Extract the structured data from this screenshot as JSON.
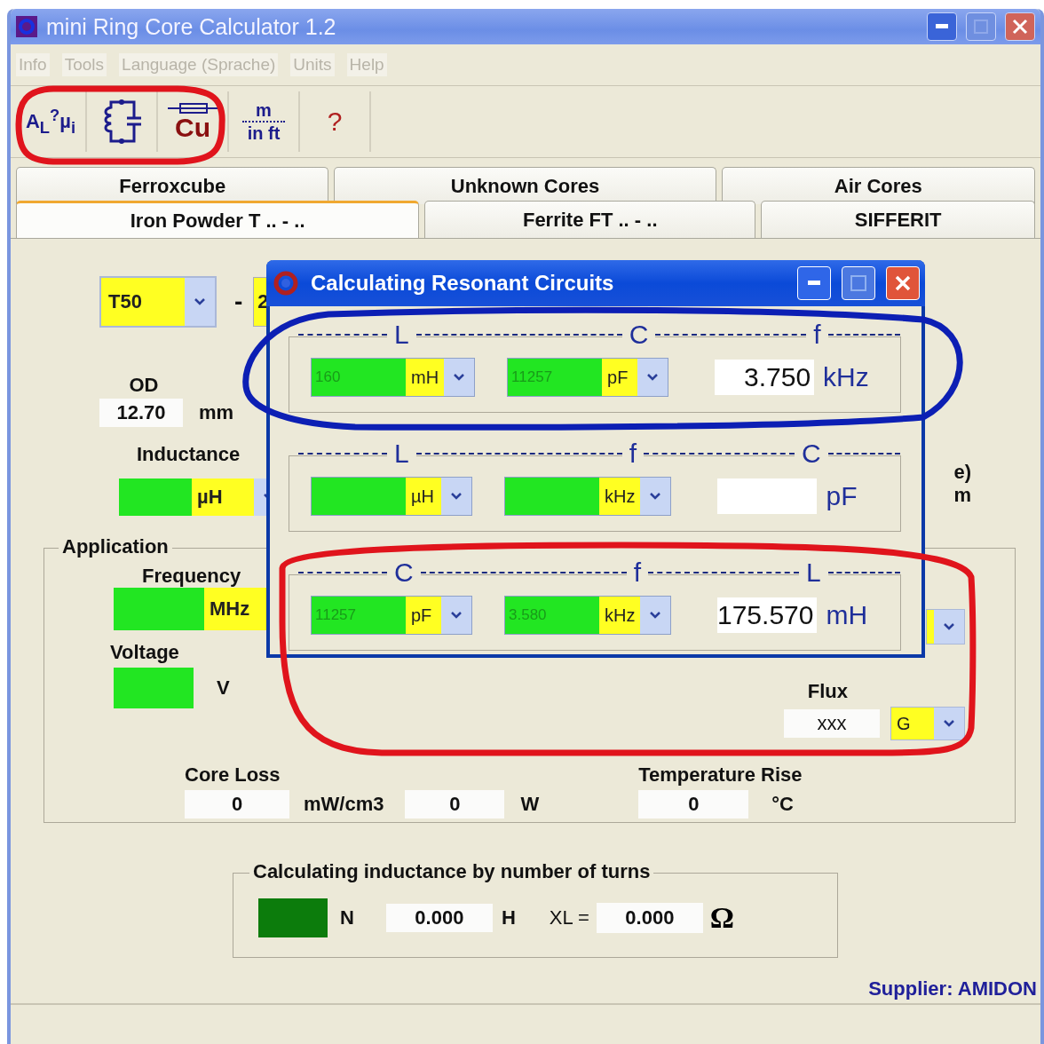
{
  "window": {
    "title": "mini Ring Core Calculator 1.2"
  },
  "menu": [
    "Info",
    "Tools",
    "Language (Sprache)",
    "Units",
    "Help"
  ],
  "toolbar": [
    {
      "kind": "formula",
      "label": "A$_{L}$$^{?}$µ$_{i}$"
    },
    {
      "kind": "circuit"
    },
    {
      "kind": "wire",
      "label": "Cu"
    },
    {
      "kind": "units",
      "label": "m",
      "sublabel": "in ft"
    },
    {
      "kind": "help",
      "label": "?"
    }
  ],
  "tab_rows": [
    [
      {
        "label": "Ferroxcube",
        "selected": false
      },
      {
        "label": "Unknown Cores",
        "selected": false
      },
      {
        "label": "Air Cores",
        "selected": false
      }
    ],
    [
      {
        "label": "Iron Powder T .. - ..",
        "selected": true
      },
      {
        "label": "Ferrite FT .. - ..",
        "selected": false
      },
      {
        "label": "SIFFERIT",
        "selected": false
      }
    ]
  ],
  "core": {
    "type": "T50",
    "separator": "-",
    "mix": "2"
  },
  "od": {
    "label": "OD",
    "value": "12.70",
    "unit": "mm"
  },
  "inductance": {
    "label": "Inductance",
    "unit": "µH"
  },
  "right_label_fragments": [
    "e)",
    "m"
  ],
  "application": {
    "title": "Application",
    "frequency": {
      "label": "Frequency",
      "unit": "MHz"
    },
    "voltage": {
      "label": "Voltage",
      "unit": "V"
    },
    "flux": {
      "label": "Flux",
      "value": "xxx",
      "unit": "G"
    },
    "core_loss": {
      "label": "Core Loss",
      "density": "0",
      "density_unit": "mW/cm3",
      "power": "0",
      "power_unit": "W"
    },
    "temperature_rise": {
      "label": "Temperature Rise",
      "value": "0",
      "unit": "°C"
    }
  },
  "turns": {
    "title": "Calculating inductance by number of turns",
    "n_label": "N",
    "inductance": "0.000",
    "inductance_unit": "H",
    "xl_label": "XL =",
    "xl": "0.000",
    "xl_unit": "Ω"
  },
  "supplier": "Supplier: AMIDON",
  "dialog": {
    "title": "Calculating Resonant Circuits",
    "rows": [
      {
        "headers": [
          "L",
          "C",
          "f"
        ],
        "input_1": {
          "value": "160",
          "unit": "mH"
        },
        "input_2": {
          "value": "11257",
          "unit": "pF"
        },
        "result": "3.750",
        "result_unit": "kHz"
      },
      {
        "headers": [
          "L",
          "f",
          "C"
        ],
        "input_1": {
          "unit": "µH"
        },
        "input_2": {
          "unit": "kHz"
        },
        "result_unit": "pF"
      },
      {
        "headers": [
          "C",
          "f",
          "L"
        ],
        "input_1": {
          "value": "11257",
          "unit": "pF"
        },
        "input_2": {
          "value": "3.580",
          "unit": "kHz"
        },
        "result": "175.570",
        "result_unit": "mH"
      }
    ]
  },
  "annotations": [
    {
      "color": "#e0141c"
    },
    {
      "color": "#0c1fb4"
    },
    {
      "color": "#e0141c"
    }
  ]
}
